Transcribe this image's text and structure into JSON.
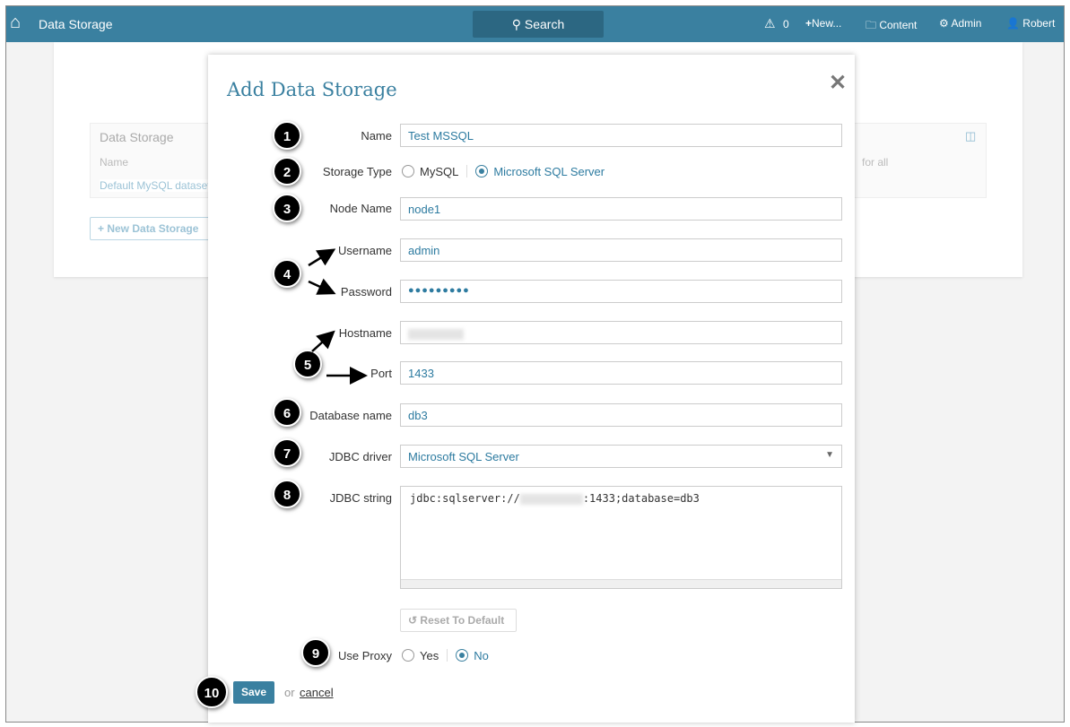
{
  "header": {
    "home_label": "Data Storage",
    "search_label": "Search",
    "alerts_count": "0",
    "new_label": "New...",
    "content_label": "Content",
    "admin_label": "Admin",
    "user_label": "Robert"
  },
  "background": {
    "table_title": "Data Storage",
    "col_name": "Name",
    "col_partial": "for all",
    "row_1": "Default MySQL dataset s",
    "new_button": "New Data Storage"
  },
  "modal": {
    "title": "Add Data Storage",
    "fields": {
      "name_label": "Name",
      "name_value": "Test MSSQL",
      "storage_type_label": "Storage Type",
      "storage_opt_1": "MySQL",
      "storage_opt_2": "Microsoft SQL Server",
      "node_label": "Node Name",
      "node_value": "node1",
      "username_label": "Username",
      "username_value": "admin",
      "password_label": "Password",
      "password_value": "●●●●●●●●●",
      "hostname_label": "Hostname",
      "port_label": "Port",
      "port_value": "1433",
      "database_label": "Database name",
      "database_value": "db3",
      "driver_label": "JDBC driver",
      "driver_value": "Microsoft SQL Server",
      "jdbc_label": "JDBC string",
      "jdbc_prefix": "jdbc:sqlserver://",
      "jdbc_suffix": ":1433;database=db3",
      "reset_label": "Reset To Default",
      "proxy_label": "Use Proxy",
      "proxy_yes": "Yes",
      "proxy_no": "No"
    },
    "save_label": "Save",
    "or_label": "or",
    "cancel_label": "cancel"
  },
  "markers": [
    "1",
    "2",
    "3",
    "4",
    "5",
    "6",
    "7",
    "8",
    "9",
    "10"
  ]
}
